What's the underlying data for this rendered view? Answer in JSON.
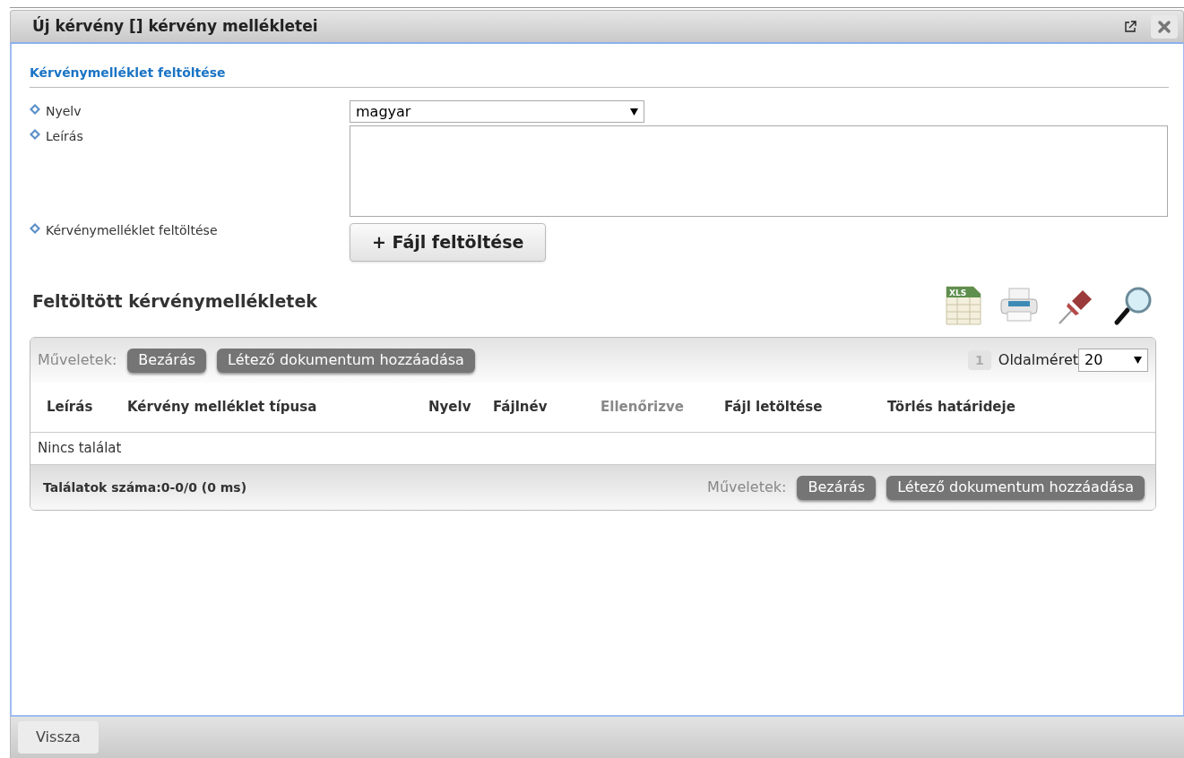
{
  "window": {
    "title": "Új kérvény [] kérvény mellékletei"
  },
  "upload_section": {
    "title": "Kérvénymelléklet feltöltése",
    "fields": [
      {
        "kind": "select",
        "label": "Nyelv",
        "value": "magyar"
      },
      {
        "kind": "textarea",
        "label": "Leírás"
      },
      {
        "kind": "upload",
        "label": "Kérvénymelléklet feltöltése",
        "button": "+ Fájl feltöltése"
      }
    ]
  },
  "grid": {
    "title": "Feltöltött kérvénymellékletek",
    "toolbar_icons": [
      {
        "kind": "xls",
        "text": "XLS"
      },
      {
        "kind": "print"
      },
      {
        "kind": "pin"
      },
      {
        "kind": "search"
      }
    ],
    "actions_label": "Műveletek:",
    "actions": [
      "Bezárás",
      "Létező dokumentum hozzáadása"
    ],
    "pager": {
      "pages": [
        {
          "label": "1",
          "selected": true
        }
      ],
      "page_size_label": "Oldalméret",
      "page_size": "20"
    },
    "columns": [
      {
        "label": "Leírás",
        "disabled": false
      },
      {
        "label": "Kérvény melléklet típusa",
        "disabled": false
      },
      {
        "label": "Nyelv",
        "disabled": false
      },
      {
        "label": "Fájlnév",
        "disabled": false
      },
      {
        "label": "Ellenőrizve",
        "disabled": true
      },
      {
        "label": "Fájl letöltése",
        "disabled": false
      },
      {
        "label": "Törlés határideje",
        "disabled": false
      }
    ],
    "empty_text": "Nincs találat",
    "result_count": "Találatok száma:0-0/0 (0 ms)",
    "footer_actions_label": "Műveletek:",
    "footer_actions": [
      "Bezárás",
      "Létező dokumentum hozzáadása"
    ]
  },
  "footer": {
    "back_button": "Vissza"
  }
}
